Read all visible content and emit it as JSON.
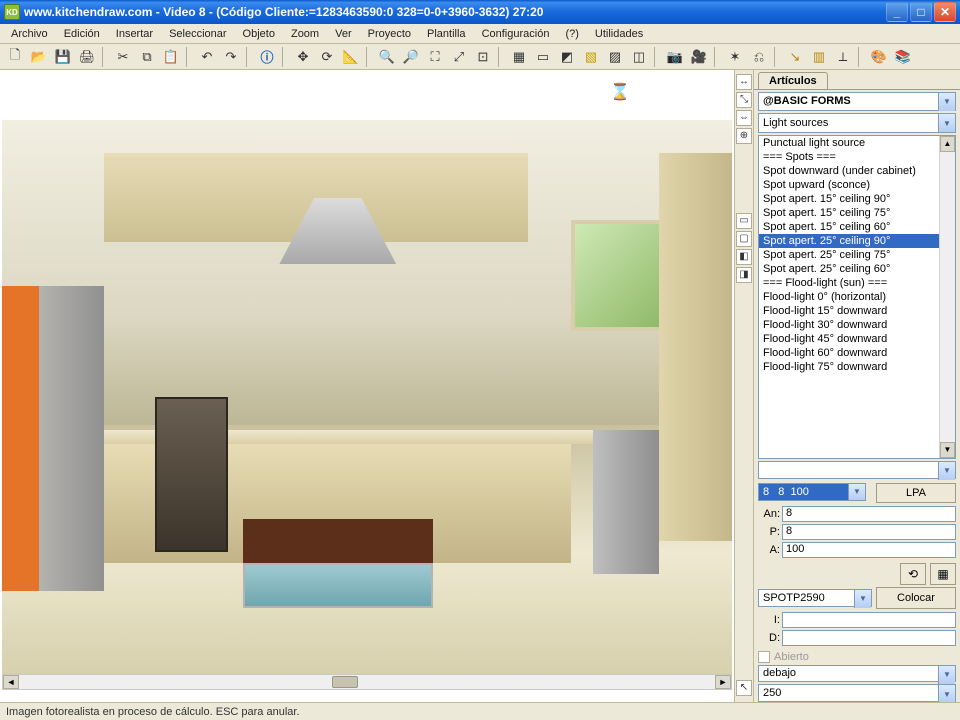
{
  "title": "www.kitchendraw.com - Video 8 - (Código Cliente:=1283463590:0 328=0-0+3960-3632) 27:20",
  "app_icon_text": "KD",
  "menu": [
    "Archivo",
    "Edición",
    "Insertar",
    "Seleccionar",
    "Objeto",
    "Zoom",
    "Ver",
    "Proyecto",
    "Plantilla",
    "Configuración",
    "(?)",
    "Utilidades"
  ],
  "panel": {
    "tab": "Artículos",
    "catalog": "@BASIC FORMS",
    "category": "Light sources",
    "items": [
      "Punctual light source",
      "=== Spots ===",
      "Spot downward (under cabinet)",
      "Spot upward (sconce)",
      "Spot apert. 15° ceiling 90°",
      "Spot apert. 15° ceiling 75°",
      "Spot apert. 15° ceiling 60°",
      "Spot apert. 25° ceiling 90°",
      "Spot apert. 25° ceiling 75°",
      "Spot apert. 25° ceiling 60°",
      "=== Flood-light (sun) ===",
      "Flood-light 0° (horizontal)",
      "Flood-light 15° downward",
      "Flood-light 30° downward",
      "Flood-light 45° downward",
      "Flood-light 60° downward",
      "Flood-light 75° downward"
    ],
    "selected_index": 7,
    "blue_value": "8   8  100",
    "lpa": "LPA",
    "dims": {
      "an_label": "An:",
      "an": "8",
      "p_label": "P:",
      "p": "8",
      "a_label": "A:",
      "a": "100"
    },
    "code": "SPOTP2590",
    "colocar": "Colocar",
    "i_label": "I:",
    "d_label": "D:",
    "abierto": "Abierto",
    "pos_dd": "debajo",
    "pos_val": "250"
  },
  "status": "Imagen fotorealista en proceso de cálculo. ESC para anular.",
  "hourglass": "⌛"
}
